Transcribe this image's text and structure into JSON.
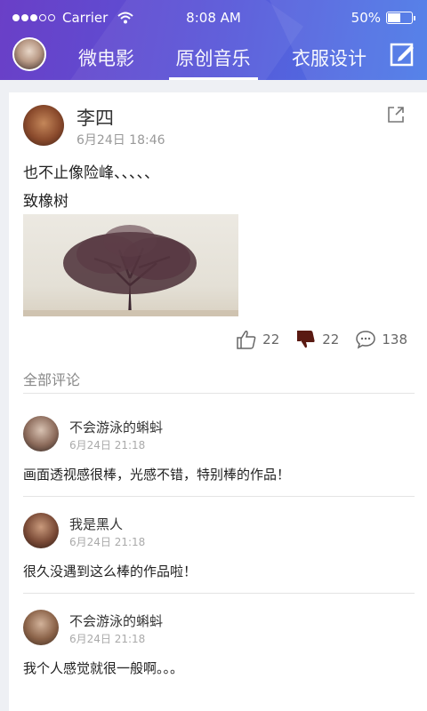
{
  "status_bar": {
    "carrier": "Carrier",
    "time": "8:08 AM",
    "battery": "50%",
    "battery_level": 0.5
  },
  "tabs": [
    {
      "label": "微电影",
      "active": false
    },
    {
      "label": "原创音乐",
      "active": true
    },
    {
      "label": "衣服设计",
      "active": false
    }
  ],
  "post": {
    "author": "李四",
    "time": "6月24日 18:46",
    "text_line1": "也不止像险峰、、、、、",
    "text_line2": "致橡树",
    "likes": "22",
    "dislikes": "22",
    "comments": "138"
  },
  "comments_section": {
    "title": "全部评论"
  },
  "comments": [
    {
      "name": "不会游泳的蝌蚪",
      "time": "6月24日 21:18",
      "text": "画面透视感很棒，光感不错，特别棒的作品！"
    },
    {
      "name": "我是黑人",
      "time": "6月24日 21:18",
      "text": "很久没遇到这么棒的作品啦！"
    },
    {
      "name": "不会游泳的蝌蚪",
      "time": "6月24日 21:18",
      "text": "我个人感觉就很一般啊。。。"
    }
  ],
  "colors": {
    "header_start": "#6a3fc7",
    "header_end": "#4a7ae8",
    "dislike_active": "#5a1a12"
  }
}
